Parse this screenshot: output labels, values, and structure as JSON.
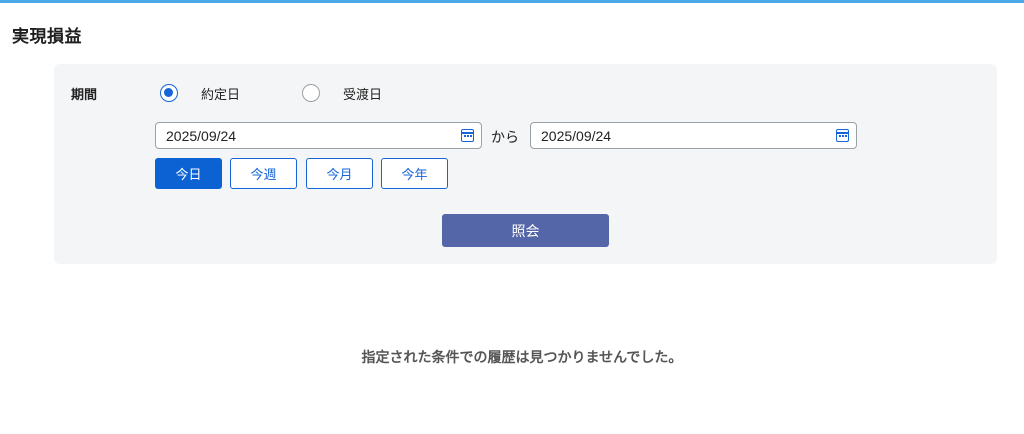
{
  "page": {
    "title": "実現損益"
  },
  "filter": {
    "period_label": "期間",
    "radio_options": [
      {
        "label": "約定日",
        "checked": true
      },
      {
        "label": "受渡日",
        "checked": false
      }
    ],
    "date_from": "2025/09/24",
    "date_separator": "から",
    "date_to": "2025/09/24",
    "quick_buttons": [
      {
        "label": "今日",
        "active": true
      },
      {
        "label": "今週",
        "active": false
      },
      {
        "label": "今月",
        "active": false
      },
      {
        "label": "今年",
        "active": false
      }
    ],
    "submit_label": "照会"
  },
  "results": {
    "empty_message": "指定された条件での履歴は見つかりませんでした。"
  },
  "colors": {
    "accent": "#1565d8",
    "submit": "#5466a8",
    "panel_bg": "#f4f5f7",
    "top_line": "#4aa8e8"
  },
  "icons": {
    "date_picker": "calendar-icon"
  }
}
